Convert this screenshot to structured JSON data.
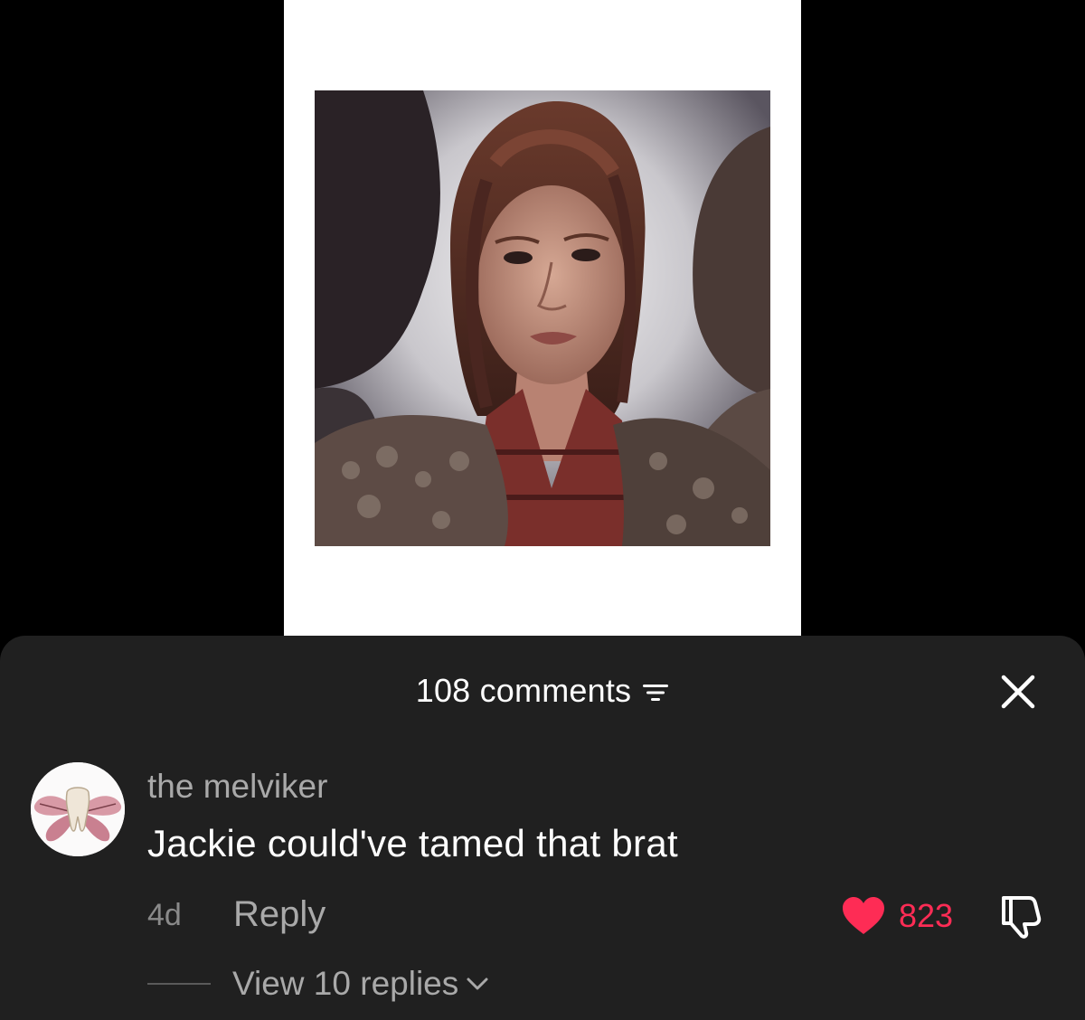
{
  "sheet": {
    "comment_count_label": "108 comments"
  },
  "comment": {
    "username": "the melviker",
    "text": "Jackie could've tamed that brat",
    "timestamp": "4d",
    "reply_label": "Reply",
    "like_count": "823",
    "view_replies_label": "View 10 replies"
  },
  "icons": {
    "filter": "filter-icon",
    "close": "close-icon",
    "heart": "heart-icon",
    "dislike": "thumbs-down-icon",
    "chevron": "chevron-down-icon"
  },
  "colors": {
    "sheet_background": "#202020",
    "like_accent": "#fe2c55",
    "secondary_text": "#a9a9a9"
  }
}
